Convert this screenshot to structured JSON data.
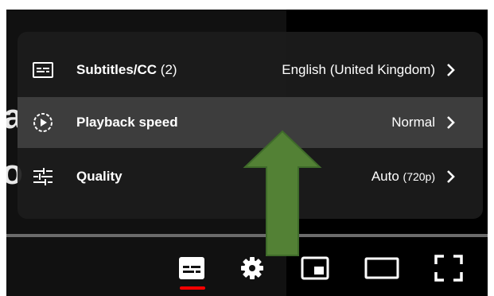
{
  "background": {
    "fragment_1": "a",
    "fragment_2": "o"
  },
  "settings_menu": {
    "items": [
      {
        "label": "Subtitles/CC",
        "count": "(2)",
        "value": "English (United Kingdom)",
        "value_sub": "",
        "icon": "subtitles-icon"
      },
      {
        "label": "Playback speed",
        "count": "",
        "value": "Normal",
        "value_sub": "",
        "icon": "playback-speed-icon"
      },
      {
        "label": "Quality",
        "count": "",
        "value": "Auto",
        "value_sub": "(720p)",
        "icon": "quality-sliders-icon"
      }
    ]
  },
  "controls": {
    "icons": [
      "subtitles-icon",
      "gear-icon",
      "miniplayer-icon",
      "theater-mode-icon",
      "fullscreen-icon"
    ],
    "active_indicator_color": "#ff0000"
  },
  "annotation": {
    "arrow_color": "#538135"
  }
}
